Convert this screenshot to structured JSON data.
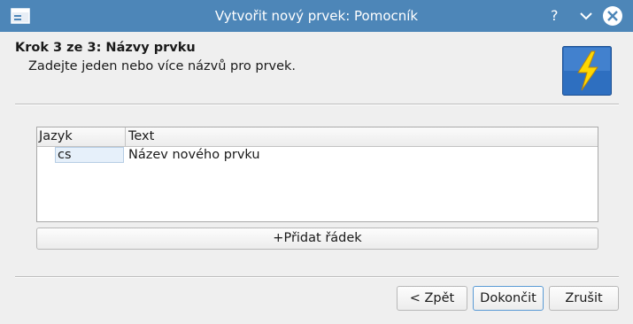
{
  "window": {
    "title": "Vytvořit nový prvek: Pomocník",
    "help_glyph": "?",
    "icons": [
      "app-window-icon",
      "help-icon",
      "minimize-icon",
      "close-icon"
    ]
  },
  "header": {
    "step_title": "Krok 3 ze 3: Názvy prvku",
    "step_description": "Zadejte jeden nebo více názvů pro prvek.",
    "icon": "lightning-icon",
    "icon_color": "#ffd700",
    "icon_bg": "#2e6fc0"
  },
  "names_table": {
    "columns": [
      "Jazyk",
      "Text"
    ],
    "rows": [
      {
        "language": "cs",
        "text": "Název nového prvku"
      }
    ]
  },
  "add_row_button": {
    "icon": "+",
    "label": "Přidat řádek"
  },
  "footer": {
    "back_label": "< Zpět",
    "finish_label": "Dokončit",
    "cancel_label": "Zrušit"
  },
  "colors": {
    "titlebar": "#4d86b8",
    "selection": "#e6f0fa",
    "focus_border": "#5b9bd5"
  }
}
